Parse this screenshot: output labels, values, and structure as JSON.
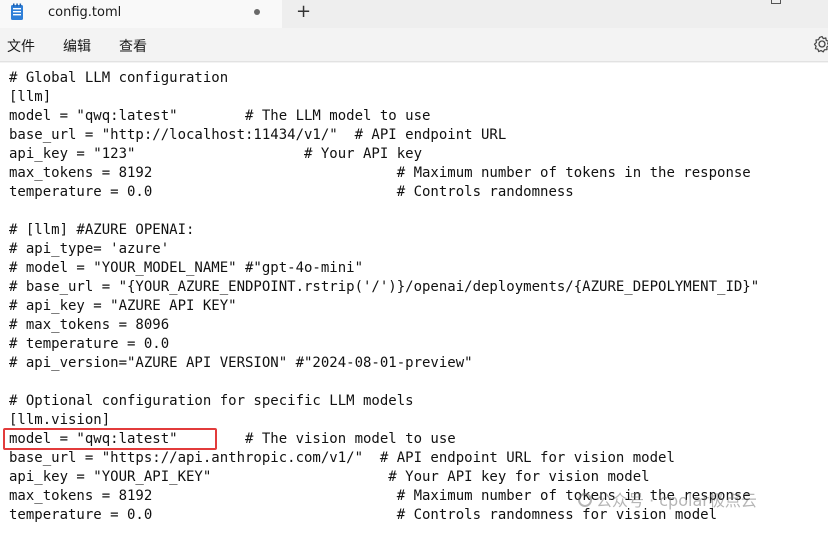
{
  "tab": {
    "title": "config.toml",
    "new_tab": "+"
  },
  "menu": {
    "file": "文件",
    "edit": "编辑",
    "view": "查看"
  },
  "editor": {
    "lines": [
      "# Global LLM configuration",
      "[llm]",
      "model = \"qwq:latest\"        # The LLM model to use",
      "base_url = \"http://localhost:11434/v1/\"  # API endpoint URL",
      "api_key = \"123\"                    # Your API key",
      "max_tokens = 8192                             # Maximum number of tokens in the response",
      "temperature = 0.0                             # Controls randomness",
      "",
      "# [llm] #AZURE OPENAI:",
      "# api_type= 'azure'",
      "# model = \"YOUR_MODEL_NAME\" #\"gpt-4o-mini\"",
      "# base_url = \"{YOUR_AZURE_ENDPOINT.rstrip('/')}/openai/deployments/{AZURE_DEPOLYMENT_ID}\"",
      "# api_key = \"AZURE API KEY\"",
      "# max_tokens = 8096",
      "# temperature = 0.0",
      "# api_version=\"AZURE API VERSION\" #\"2024-08-01-preview\"",
      "",
      "# Optional configuration for specific LLM models",
      "[llm.vision]",
      "model = \"qwq:latest\"        # The vision model to use",
      "base_url = \"https://api.anthropic.com/v1/\"  # API endpoint URL for vision model",
      "api_key = \"YOUR_API_KEY\"                     # Your API key for vision model",
      "max_tokens = 8192                             # Maximum number of tokens in the response",
      "temperature = 0.0                             # Controls randomness for vision model"
    ]
  },
  "watermark": {
    "text": "公众号 · cpolar极点云"
  },
  "colors": {
    "highlight": "#e23b3b",
    "tab_icon": "#2f7fd8"
  }
}
